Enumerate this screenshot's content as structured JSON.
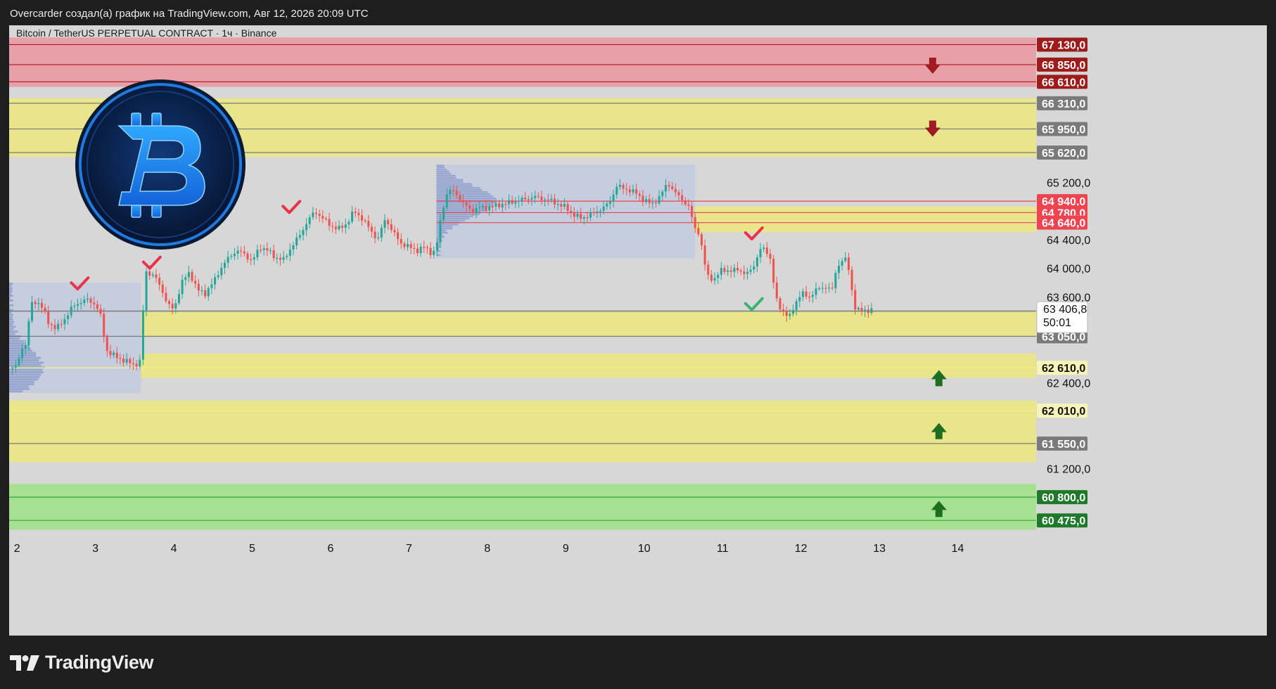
{
  "header": {
    "publish_line": "Overcarder создал(а) график на TradingView.com, Авг 12, 2026 20:09 UTC"
  },
  "chart": {
    "symbol_title": "Bitcoin / TetherUS PERPETUAL CONTRACT · 1ч · Binance"
  },
  "footer": {
    "brand": "TradingView"
  },
  "colors": {
    "background": "#d7d7d7",
    "up_candle": "#26a69a",
    "down_candle": "#ef5350",
    "red_zone": "#e8a0a8",
    "yellow_zone": "#e9e58a",
    "green_zone": "#a6e090",
    "resistance_label": "#9e1b1b",
    "support_label": "#1e7a2a"
  },
  "chart_data": {
    "type": "candlestick",
    "title": "Bitcoin / TetherUS PERPETUAL CONTRACT · 1ч · Binance",
    "timeframe": "1ч",
    "exchange": "Binance",
    "xlabel": "",
    "ylabel": "",
    "ylim": [
      60300,
      67400
    ],
    "xlim": [
      1.9,
      15.0
    ],
    "grid": false,
    "x_ticks": [
      "2",
      "3",
      "4",
      "5",
      "6",
      "7",
      "8",
      "9",
      "10",
      "11",
      "12",
      "13",
      "14"
    ],
    "x_tick_values": [
      2,
      3,
      4,
      5,
      6,
      7,
      8,
      9,
      10,
      11,
      12,
      13,
      14
    ],
    "y_ticks": [
      "65 200,0",
      "64 400,0",
      "64 000,0",
      "63 600,0",
      "62 400,0",
      "61 200,0"
    ],
    "y_tick_values": [
      65200,
      64400,
      64000,
      63600,
      62400,
      61200
    ],
    "last_price": {
      "value": 63406.8,
      "label": "63 406,8",
      "countdown": "50:01"
    },
    "price_levels": [
      {
        "value": 67130,
        "label": "67 130,0",
        "kind": "resistance"
      },
      {
        "value": 66850,
        "label": "66 850,0",
        "kind": "resistance"
      },
      {
        "value": 66610,
        "label": "66 610,0",
        "kind": "resistance"
      },
      {
        "value": 66310,
        "label": "66 310,0",
        "kind": "level"
      },
      {
        "value": 65950,
        "label": "65 950,0",
        "kind": "level"
      },
      {
        "value": 65620,
        "label": "65 620,0",
        "kind": "level"
      },
      {
        "value": 64940,
        "label": "64 940,0",
        "kind": "red-line"
      },
      {
        "value": 64780,
        "label": "64 780,0",
        "kind": "red-line"
      },
      {
        "value": 64640,
        "label": "64 640,0",
        "kind": "red-line"
      },
      {
        "value": 63400,
        "label": "63 400,0",
        "kind": "level"
      },
      {
        "value": 63050,
        "label": "63 050,0",
        "kind": "level"
      },
      {
        "value": 62610,
        "label": "62 610,0",
        "kind": "yellow-line"
      },
      {
        "value": 62010,
        "label": "62 010,0",
        "kind": "yellow-line"
      },
      {
        "value": 61550,
        "label": "61 550,0",
        "kind": "level"
      },
      {
        "value": 60800,
        "label": "60 800,0",
        "kind": "support"
      },
      {
        "value": 60475,
        "label": "60 475,0",
        "kind": "support"
      }
    ],
    "zones": [
      {
        "kind": "red",
        "from": 66540,
        "to": 67230
      },
      {
        "kind": "yellow",
        "from": 65560,
        "to": 66380
      },
      {
        "kind": "yellow",
        "from": 64505,
        "to": 64865,
        "x_start": 10.6
      },
      {
        "kind": "yellow",
        "from": 63050,
        "to": 63400,
        "x_start": 3.58
      },
      {
        "kind": "yellow",
        "from": 62470,
        "to": 62810,
        "x_start": 3.58
      },
      {
        "kind": "yellow",
        "from": 61290,
        "to": 62150
      },
      {
        "kind": "green",
        "from": 60345,
        "to": 60985
      }
    ],
    "volume_profiles": [
      {
        "x_start": 1.9,
        "x_end": 3.58,
        "from": 62260,
        "to": 63800,
        "poc": 62610
      },
      {
        "x_start": 7.35,
        "x_end": 10.65,
        "from": 64140,
        "to": 65450,
        "poc": 64940
      }
    ],
    "annotations": [
      {
        "kind": "check",
        "color": "red",
        "x": 2.8,
        "y": 63770
      },
      {
        "kind": "check",
        "color": "red",
        "x": 3.72,
        "y": 64060
      },
      {
        "kind": "check",
        "color": "red",
        "x": 5.5,
        "y": 64840
      },
      {
        "kind": "check",
        "color": "red",
        "x": 11.4,
        "y": 64470
      },
      {
        "kind": "check",
        "color": "green",
        "x": 11.4,
        "y": 63480
      },
      {
        "kind": "arrow-down",
        "color": "dark-red",
        "x": 13.68,
        "y": 66830
      },
      {
        "kind": "arrow-down",
        "color": "dark-red",
        "x": 13.68,
        "y": 65950
      },
      {
        "kind": "arrow-up",
        "color": "green",
        "x": 13.76,
        "y": 62470
      },
      {
        "kind": "arrow-up",
        "color": "green",
        "x": 13.76,
        "y": 61730
      },
      {
        "kind": "arrow-up",
        "color": "green",
        "x": 13.76,
        "y": 60640
      }
    ],
    "price_path": [
      [
        1.9,
        62600
      ],
      [
        2.0,
        62630
      ],
      [
        2.07,
        62920
      ],
      [
        2.1,
        62850
      ],
      [
        2.15,
        63260
      ],
      [
        2.2,
        63550
      ],
      [
        2.3,
        63500
      ],
      [
        2.4,
        63250
      ],
      [
        2.5,
        63150
      ],
      [
        2.6,
        63280
      ],
      [
        2.7,
        63450
      ],
      [
        2.8,
        63530
      ],
      [
        2.9,
        63560
      ],
      [
        3.0,
        63500
      ],
      [
        3.08,
        63300
      ],
      [
        3.13,
        62870
      ],
      [
        3.2,
        62800
      ],
      [
        3.35,
        62720
      ],
      [
        3.5,
        62650
      ],
      [
        3.57,
        62700
      ],
      [
        3.6,
        63300
      ],
      [
        3.65,
        63950
      ],
      [
        3.75,
        63900
      ],
      [
        3.85,
        63700
      ],
      [
        3.92,
        63500
      ],
      [
        4.0,
        63420
      ],
      [
        4.1,
        63800
      ],
      [
        4.2,
        63950
      ],
      [
        4.3,
        63700
      ],
      [
        4.4,
        63650
      ],
      [
        4.5,
        63800
      ],
      [
        4.6,
        64000
      ],
      [
        4.7,
        64150
      ],
      [
        4.8,
        64250
      ],
      [
        4.9,
        64200
      ],
      [
        5.0,
        64100
      ],
      [
        5.1,
        64300
      ],
      [
        5.2,
        64250
      ],
      [
        5.3,
        64150
      ],
      [
        5.4,
        64120
      ],
      [
        5.5,
        64300
      ],
      [
        5.6,
        64450
      ],
      [
        5.7,
        64650
      ],
      [
        5.8,
        64800
      ],
      [
        5.9,
        64700
      ],
      [
        6.0,
        64600
      ],
      [
        6.1,
        64550
      ],
      [
        6.2,
        64620
      ],
      [
        6.3,
        64800
      ],
      [
        6.4,
        64700
      ],
      [
        6.5,
        64550
      ],
      [
        6.6,
        64400
      ],
      [
        6.7,
        64700
      ],
      [
        6.8,
        64500
      ],
      [
        6.9,
        64350
      ],
      [
        7.0,
        64300
      ],
      [
        7.1,
        64250
      ],
      [
        7.2,
        64300
      ],
      [
        7.3,
        64200
      ],
      [
        7.35,
        64300
      ],
      [
        7.42,
        64800
      ],
      [
        7.5,
        65100
      ],
      [
        7.6,
        65050
      ],
      [
        7.7,
        64900
      ],
      [
        7.8,
        64800
      ],
      [
        7.9,
        64850
      ],
      [
        8.0,
        64850
      ],
      [
        8.2,
        64900
      ],
      [
        8.4,
        64950
      ],
      [
        8.6,
        65000
      ],
      [
        8.8,
        64950
      ],
      [
        9.0,
        64850
      ],
      [
        9.1,
        64750
      ],
      [
        9.2,
        64700
      ],
      [
        9.4,
        64800
      ],
      [
        9.55,
        64900
      ],
      [
        9.65,
        65150
      ],
      [
        9.8,
        65100
      ],
      [
        9.9,
        65050
      ],
      [
        10.0,
        64950
      ],
      [
        10.1,
        64900
      ],
      [
        10.2,
        65000
      ],
      [
        10.3,
        65200
      ],
      [
        10.4,
        65050
      ],
      [
        10.5,
        64950
      ],
      [
        10.57,
        64850
      ],
      [
        10.65,
        64560
      ],
      [
        10.7,
        64500
      ],
      [
        10.75,
        64200
      ],
      [
        10.8,
        63900
      ],
      [
        10.9,
        63850
      ],
      [
        11.0,
        64000
      ],
      [
        11.1,
        63950
      ],
      [
        11.2,
        64000
      ],
      [
        11.3,
        63900
      ],
      [
        11.4,
        64050
      ],
      [
        11.5,
        64300
      ],
      [
        11.6,
        64200
      ],
      [
        11.65,
        63800
      ],
      [
        11.7,
        63500
      ],
      [
        11.78,
        63400
      ],
      [
        11.85,
        63300
      ],
      [
        11.92,
        63500
      ],
      [
        12.0,
        63650
      ],
      [
        12.1,
        63600
      ],
      [
        12.2,
        63700
      ],
      [
        12.3,
        63750
      ],
      [
        12.4,
        63700
      ],
      [
        12.45,
        64000
      ],
      [
        12.55,
        64150
      ],
      [
        12.6,
        64050
      ],
      [
        12.65,
        63700
      ],
      [
        12.7,
        63400
      ],
      [
        12.8,
        63420
      ],
      [
        12.9,
        63407
      ]
    ]
  }
}
